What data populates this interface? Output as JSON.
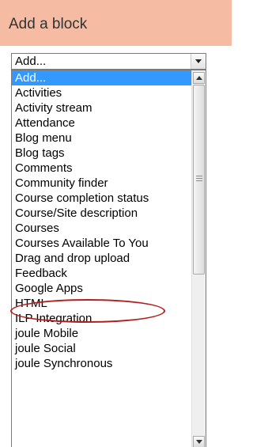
{
  "header": {
    "title": "Add a block"
  },
  "select": {
    "value": "Add..."
  },
  "list": {
    "items": [
      {
        "label": "Add...",
        "selected": true
      },
      {
        "label": "Activities"
      },
      {
        "label": "Activity stream"
      },
      {
        "label": "Attendance"
      },
      {
        "label": "Blog menu"
      },
      {
        "label": "Blog tags"
      },
      {
        "label": "Comments"
      },
      {
        "label": "Community finder"
      },
      {
        "label": "Course completion status"
      },
      {
        "label": "Course/Site description"
      },
      {
        "label": "Courses"
      },
      {
        "label": "Courses Available To You"
      },
      {
        "label": "Drag and drop upload"
      },
      {
        "label": "Feedback"
      },
      {
        "label": "Google Apps"
      },
      {
        "label": "HTML"
      },
      {
        "label": "ILP Integration"
      },
      {
        "label": "joule Mobile"
      },
      {
        "label": "joule Social"
      },
      {
        "label": "joule Synchronous"
      }
    ]
  },
  "colors": {
    "header_bg": "#f6bba3",
    "selected_bg": "#3399ff",
    "highlight_ellipse": "#b21e1e"
  }
}
